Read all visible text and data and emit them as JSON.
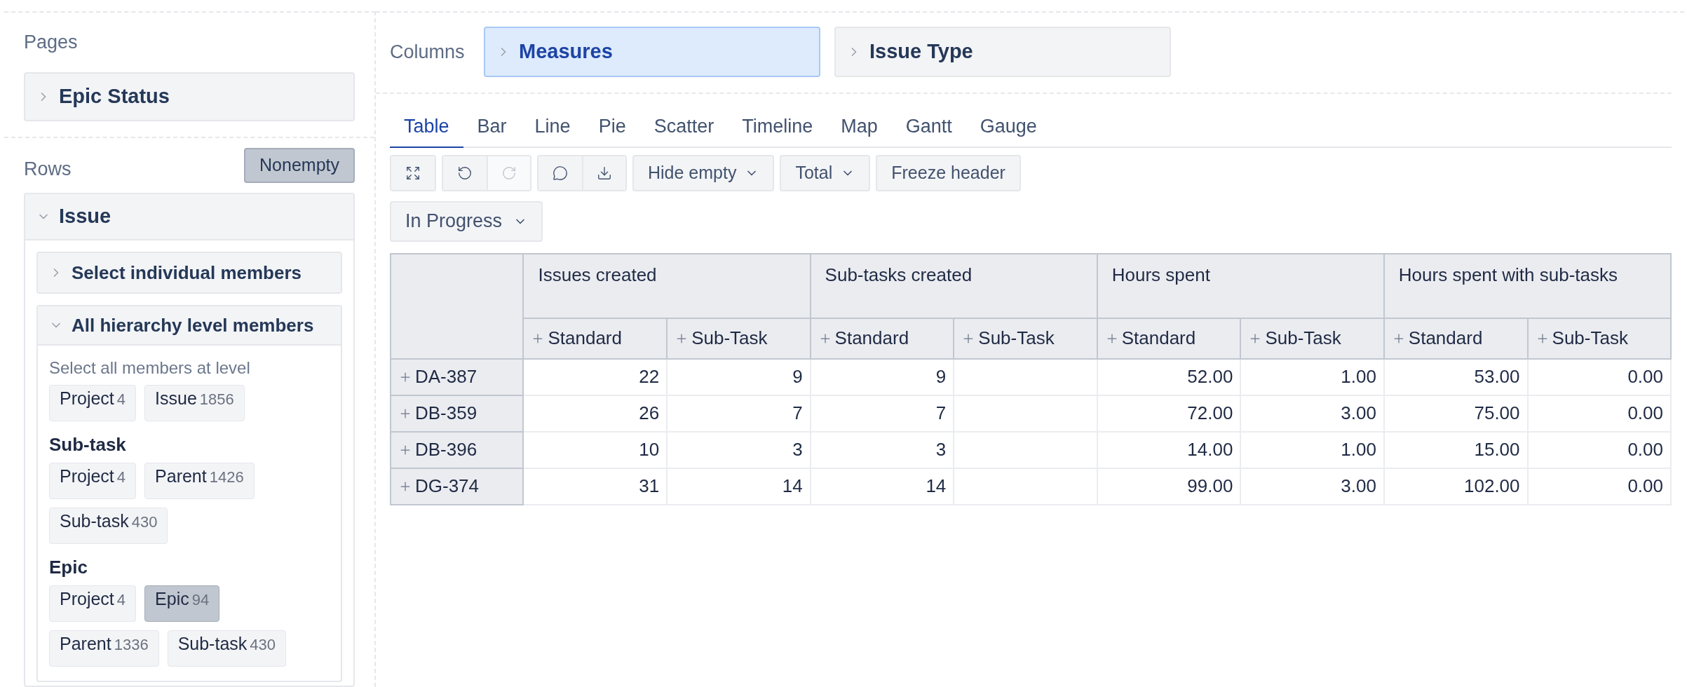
{
  "pages": {
    "label": "Pages",
    "items": [
      {
        "label": "Epic Status",
        "expanded": false
      }
    ]
  },
  "rows": {
    "label": "Rows",
    "nonempty": {
      "label": "Nonempty",
      "on": true
    },
    "dimension": {
      "label": "Issue",
      "expanded": true,
      "sections": [
        {
          "label": "Select individual members",
          "expanded": false
        },
        {
          "label": "All hierarchy level members",
          "expanded": true,
          "hint": "Select all members at level",
          "groups": [
            {
              "chips": [
                {
                  "label": "Project",
                  "count": "4",
                  "selected": false
                },
                {
                  "label": "Issue",
                  "count": "1856",
                  "selected": false
                }
              ]
            },
            {
              "title": "Sub-task",
              "chips": [
                {
                  "label": "Project",
                  "count": "4",
                  "selected": false
                },
                {
                  "label": "Parent",
                  "count": "1426",
                  "selected": false
                },
                {
                  "label": "Sub-task",
                  "count": "430",
                  "selected": false
                }
              ]
            },
            {
              "title": "Epic",
              "chips": [
                {
                  "label": "Project",
                  "count": "4",
                  "selected": false
                },
                {
                  "label": "Epic",
                  "count": "94",
                  "selected": true
                },
                {
                  "label": "Parent",
                  "count": "1336",
                  "selected": false
                },
                {
                  "label": "Sub-task",
                  "count": "430",
                  "selected": false
                }
              ]
            }
          ]
        }
      ]
    }
  },
  "columns": {
    "label": "Columns",
    "items": [
      {
        "label": "Measures",
        "selected": true
      },
      {
        "label": "Issue Type",
        "selected": false
      }
    ]
  },
  "tabs": [
    {
      "label": "Table",
      "selected": true
    },
    {
      "label": "Bar",
      "selected": false
    },
    {
      "label": "Line",
      "selected": false
    },
    {
      "label": "Pie",
      "selected": false
    },
    {
      "label": "Scatter",
      "selected": false
    },
    {
      "label": "Timeline",
      "selected": false
    },
    {
      "label": "Map",
      "selected": false
    },
    {
      "label": "Gantt",
      "selected": false
    },
    {
      "label": "Gauge",
      "selected": false
    }
  ],
  "toolbar": {
    "icon_groups": [
      [
        {
          "disabled": false
        }
      ],
      [
        {
          "disabled": false
        },
        {
          "disabled": true
        }
      ],
      [
        {
          "disabled": false
        },
        {
          "disabled": false
        }
      ]
    ],
    "buttons": [
      {
        "label": "Hide empty",
        "kind": "dropdown"
      },
      {
        "label": "Total",
        "kind": "dropdown"
      },
      {
        "label": "Freeze header",
        "kind": "button"
      }
    ]
  },
  "filter": {
    "label": "In Progress"
  },
  "table": {
    "column_groups": [
      {
        "label": "Issues created",
        "columns": [
          "Standard",
          "Sub-Task"
        ]
      },
      {
        "label": "Sub-tasks created",
        "columns": [
          "Standard",
          "Sub-Task"
        ]
      },
      {
        "label": "Hours spent",
        "columns": [
          "Standard",
          "Sub-Task"
        ]
      },
      {
        "label": "Hours spent with sub-tasks",
        "columns": [
          "Standard",
          "Sub-Task"
        ]
      }
    ],
    "rows": [
      {
        "label": "DA-387",
        "cells": [
          "22",
          "9",
          "9",
          null,
          "52.00",
          "1.00",
          "53.00",
          "0.00"
        ]
      },
      {
        "label": "DB-359",
        "cells": [
          "26",
          "7",
          "7",
          null,
          "72.00",
          "3.00",
          "75.00",
          "0.00"
        ]
      },
      {
        "label": "DB-396",
        "cells": [
          "10",
          "3",
          "3",
          null,
          "14.00",
          "1.00",
          "15.00",
          "0.00"
        ]
      },
      {
        "label": "DG-374",
        "cells": [
          "31",
          "14",
          "14",
          null,
          "99.00",
          "3.00",
          "102.00",
          "0.00"
        ]
      }
    ]
  }
}
